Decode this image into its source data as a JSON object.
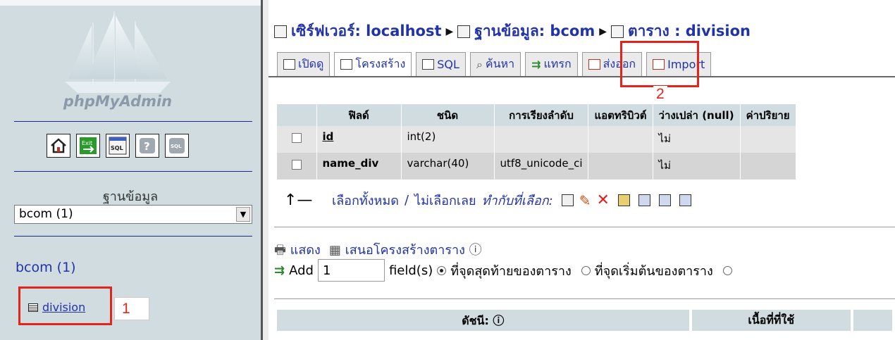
{
  "sidebar": {
    "logo_text": "phpMyAdmin",
    "database_label": "ฐานข้อมูล",
    "database_select": "bcom (1)",
    "database_heading": "bcom (1)",
    "table_item": "division",
    "icons": [
      "home-icon",
      "exit-icon",
      "sql-window-icon",
      "help-icon",
      "sql-docs-icon"
    ]
  },
  "breadcrumb": {
    "server": "เซิร์ฟเวอร์: localhost",
    "database": "ฐานข้อมูล: bcom",
    "table": "ตาราง : division"
  },
  "tabs": [
    {
      "label": "เปิดดู",
      "icon": "browse-icon"
    },
    {
      "label": "โครงสร้าง",
      "icon": "structure-icon"
    },
    {
      "label": "SQL",
      "icon": "sql-icon"
    },
    {
      "label": "ค้นหา",
      "icon": "search-icon"
    },
    {
      "label": "แทรก",
      "icon": "insert-icon"
    },
    {
      "label": "ส่งออก",
      "icon": "export-icon"
    },
    {
      "label": "Import",
      "icon": "import-icon"
    }
  ],
  "callouts": {
    "table_number": "1",
    "insert_number": "2"
  },
  "structure": {
    "headers": [
      "ฟิลด์",
      "ชนิด",
      "การเรียงลำดับ",
      "แอตทริบิวต์",
      "ว่างเปล่า (null)",
      "ค่าปริยาย"
    ],
    "rows": [
      {
        "field": "id",
        "type": "int(2)",
        "collation": "",
        "attributes": "",
        "null": "ไม่",
        "default": ""
      },
      {
        "field": "name_div",
        "type": "varchar(40)",
        "collation": "utf8_unicode_ci",
        "attributes": "",
        "null": "ไม่",
        "default": ""
      }
    ]
  },
  "with_selected": {
    "check_all": "เลือกทั้งหมด",
    "separator": "/",
    "uncheck_all": "ไม่เลือกเลย",
    "label": "ทำกับที่เลือก:"
  },
  "actions": {
    "print_view": "แสดง",
    "propose_structure": "เสนอโครงสร้างตาราง"
  },
  "add_field": {
    "label": "Add",
    "value": "1",
    "suffix": "field(s)",
    "opt_end": "ที่จุดสุดท้ายของตาราง",
    "opt_start": "ที่จุดเริ่มต้นของตาราง"
  },
  "indexes": {
    "header": "ดัชนี:",
    "space_header": "เนื้อที่ที่ใช้"
  },
  "colors": {
    "sidebar_bg": "#d0dce0",
    "link": "#2233aa",
    "callout": "#e4231b"
  }
}
